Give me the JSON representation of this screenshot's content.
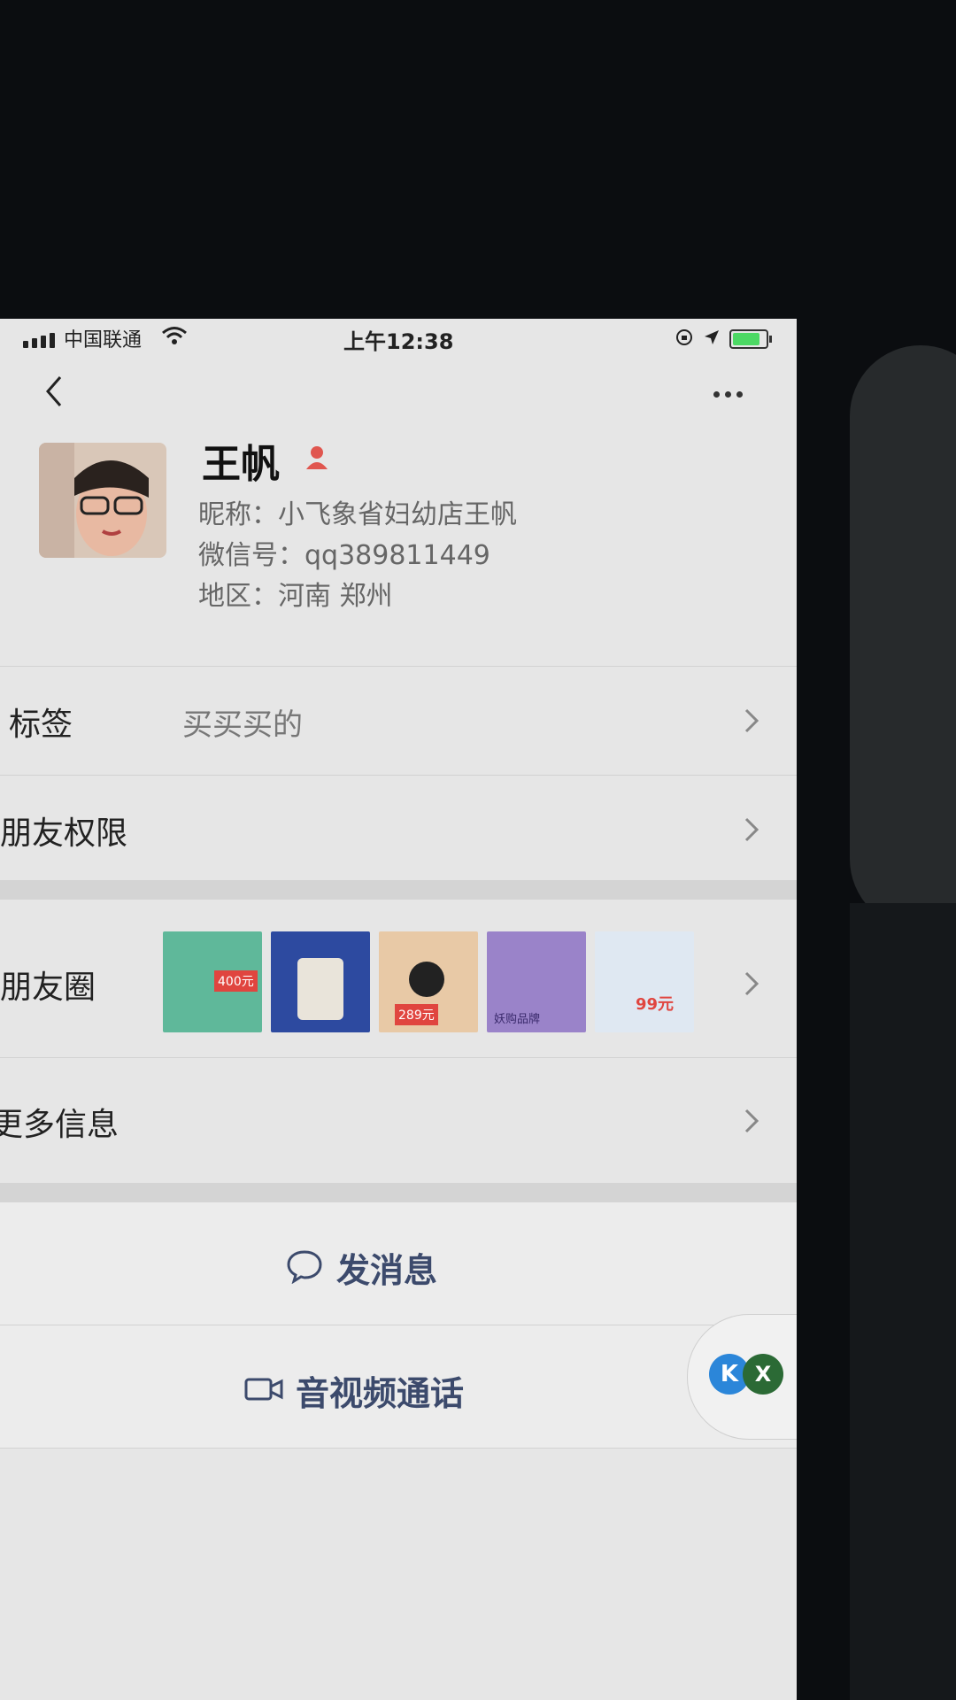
{
  "status_bar": {
    "carrier": "中国联通",
    "time": "上午12:38"
  },
  "profile": {
    "name": "王帆",
    "nickname": "昵称：小飞象省妇幼店王帆",
    "wechat_id": "微信号：qq389811449",
    "region": "地区：河南 郑州"
  },
  "rows": {
    "tags": {
      "label": "标签",
      "value": "买买买的"
    },
    "permissions": {
      "label": "朋友权限"
    },
    "moments": {
      "label": "朋友圈",
      "thumbnails": [
        {
          "text": "400元",
          "bg": "#5fb89a"
        },
        {
          "text": "",
          "bg": "#2d4aa0"
        },
        {
          "text": "289元",
          "bg": "#e8c9a6"
        },
        {
          "text": "妖购品牌",
          "bg": "#9a83c9"
        },
        {
          "text": "99元",
          "bg": "#dfe8f2"
        }
      ]
    },
    "more_info": {
      "label": "更多信息"
    }
  },
  "actions": {
    "send_message": "发消息",
    "video_call": "音视频通话"
  },
  "float_widget": {
    "btn1": "K",
    "btn2": "X"
  },
  "colors": {
    "action_text": "#3c4a6c",
    "page_bg": "#e6e6e6"
  }
}
